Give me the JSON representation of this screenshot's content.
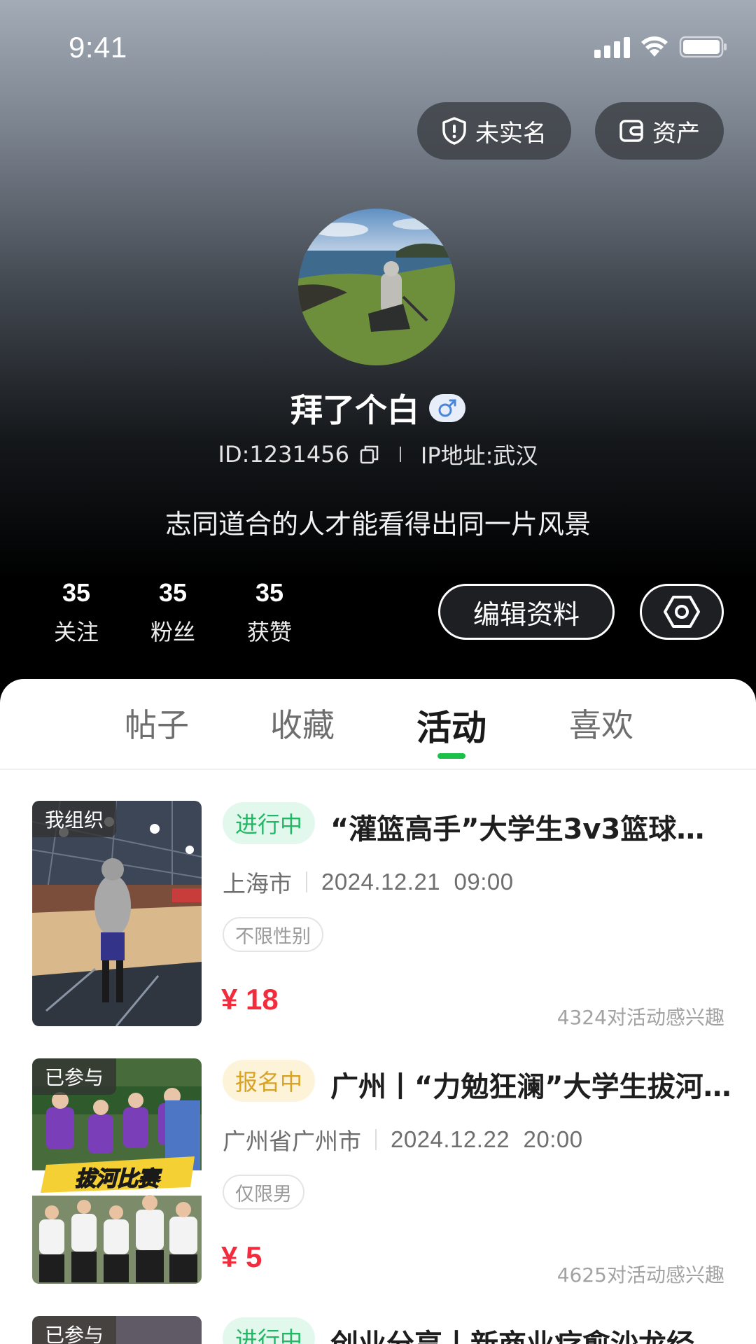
{
  "status_bar": {
    "time": "9:41"
  },
  "top_actions": {
    "verify_label": "未实名",
    "assets_label": "资产"
  },
  "profile": {
    "username": "拜了个白",
    "gender_symbol": "♂",
    "id_text": "ID:1231456",
    "ip_text": "IP地址:武汉",
    "bio": "志同道合的人才能看得出同一片风景"
  },
  "stats": [
    {
      "value": "35",
      "label": "关注"
    },
    {
      "value": "35",
      "label": "粉丝"
    },
    {
      "value": "35",
      "label": "获赞"
    }
  ],
  "actions": {
    "edit_label": "编辑资料"
  },
  "tabs": [
    {
      "label": "帖子",
      "active": false
    },
    {
      "label": "收藏",
      "active": false
    },
    {
      "label": "活动",
      "active": true
    },
    {
      "label": "喜欢",
      "active": false
    }
  ],
  "activities": [
    {
      "tag": "我组织",
      "status": "进行中",
      "title": "“灌篮高手”大学生3v3篮球挑…",
      "city": "上海市",
      "datetime": "2024.12.21  09:00",
      "gender": "不限性别",
      "price": "¥ 18",
      "interest": "4324对活动感兴趣"
    },
    {
      "tag": "已参与",
      "status": "报名中",
      "title": "广州丨“力勉狂澜”大学生拔河…",
      "city": "广州省广州市",
      "datetime": "2024.12.22  20:00",
      "gender": "仅限男",
      "price": "¥ 5",
      "interest": "4625对活动感兴趣",
      "banner_text": "拔河比赛"
    },
    {
      "tag": "已参与",
      "status": "进行中",
      "title": "创业分享丨新商业疗愈沙龙经…"
    }
  ],
  "colors": {
    "accent_green": "#19c148",
    "price_red": "#f22b3d",
    "chip_green": "#23b765",
    "chip_yellow": "#d8a325"
  }
}
